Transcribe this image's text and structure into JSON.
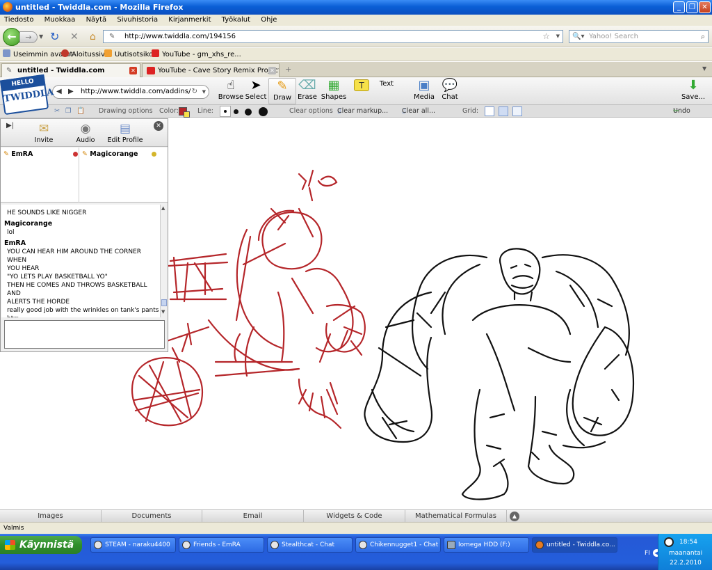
{
  "window": {
    "title": "untitled - Twiddla.com - Mozilla Firefox"
  },
  "menu": [
    "Tiedosto",
    "Muokkaa",
    "Näytä",
    "Sivuhistoria",
    "Kirjanmerkit",
    "Työkalut",
    "Ohje"
  ],
  "nav": {
    "url": "http://www.twiddla.com/194156",
    "search_placeholder": "Yahoo! Search"
  },
  "bookmarks": [
    "Useimmin avatut",
    "Aloitussivu",
    "Uutisotsikot",
    "YouTube - gm_xhs_re..."
  ],
  "tabs": [
    {
      "label": "untitled - Twiddla.com",
      "active": true
    },
    {
      "label": "YouTube - Cave Story Remix Project - ...",
      "active": false
    }
  ],
  "twiddla": {
    "logo_top": "HELLO",
    "logo_brand": "TWIDDLA",
    "url": "http://www.twiddla.com/addins/bl",
    "tools": [
      "Browse",
      "Select",
      "Draw",
      "Erase",
      "Shapes",
      "Text",
      "Media",
      "Chat"
    ],
    "text_tool": "T",
    "save": "Save...",
    "options": {
      "drawing": "Drawing options",
      "color": "Color:",
      "line": "Line:",
      "clear": "Clear options",
      "clear_markup": "Clear markup...",
      "clear_all": "Clear all...",
      "grid": "Grid:",
      "undo": "Undo"
    },
    "accent_color": "#b5262a"
  },
  "panel": {
    "tools": [
      "Invite",
      "Audio",
      "Edit Profile"
    ],
    "users": [
      {
        "name": "EmRA",
        "status_color": "#cc3333"
      },
      {
        "name": "Magicorange",
        "status_color": "#d4b52a"
      }
    ],
    "chat": [
      {
        "name": "",
        "lines": [
          "HE SOUNDS LIKE NIGGER"
        ]
      },
      {
        "name": "Magicorange",
        "lines": [
          "lol"
        ]
      },
      {
        "name": "EmRA",
        "lines": [
          "YOU CAN HEAR HIM AROUND THE CORNER WHEN",
          "YOU HEAR",
          "\"YO LETS PLAY BASKETBALL YO\"",
          "THEN HE COMES AND THROWS BASKETBALL",
          "AND",
          "ALERTS THE HORDE",
          "really good job with the wrinkles on tank's pants",
          "btw"
        ]
      }
    ]
  },
  "bottom_tabs": [
    "Images",
    "Documents",
    "Email",
    "Widgets & Code",
    "Mathematical Formulas"
  ],
  "status": "Valmis",
  "taskbar": {
    "start": "Käynnistä",
    "tasks": [
      "STEAM - naraku4400",
      "Friends - EmRA",
      "Stealthcat - Chat",
      "Chikennugget1 - Chat",
      "Iomega HDD (F:)",
      "untitled - Twiddla.co..."
    ],
    "lang": "FI",
    "time": "18:54",
    "day": "maanantai",
    "date": "22.2.2010"
  }
}
